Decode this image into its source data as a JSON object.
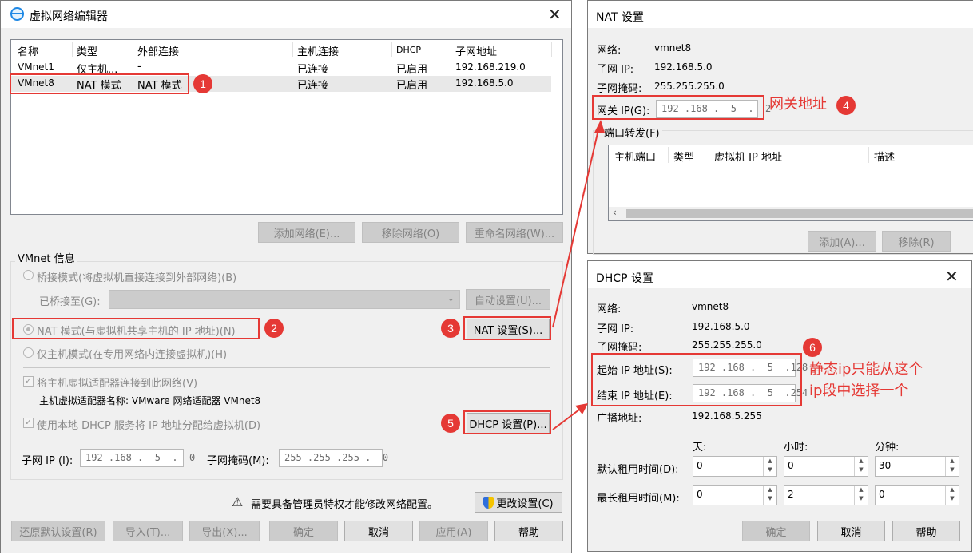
{
  "colors": {
    "accent": "#e53935",
    "dialog_bg": "#f0f0f0"
  },
  "main": {
    "title": "虚拟网络编辑器",
    "table": {
      "headers": [
        "名称",
        "类型",
        "外部连接",
        "主机连接",
        "DHCP",
        "子网地址"
      ],
      "rows": [
        [
          "VMnet1",
          "仅主机...",
          "-",
          "已连接",
          "已启用",
          "192.168.219.0"
        ],
        [
          "VMnet8",
          "NAT 模式",
          "NAT 模式",
          "已连接",
          "已启用",
          "192.168.5.0"
        ]
      ]
    },
    "add_network": "添加网络(E)...",
    "remove_network": "移除网络(O)",
    "rename_network": "重命名网络(W)...",
    "vmnet_info": "VMnet 信息",
    "bridge_mode": "桥接模式(将虚拟机直接连接到外部网络)(B)",
    "bridged_to": "已桥接至(G):",
    "auto_settings": "自动设置(U)...",
    "nat_mode": "NAT 模式(与虚拟机共享主机的 IP 地址)(N)",
    "nat_settings": "NAT 设置(S)...",
    "host_only_mode": "仅主机模式(在专用网络内连接虚拟机)(H)",
    "connect_adapter": "将主机虚拟适配器连接到此网络(V)",
    "adapter_name": "主机虚拟适配器名称: VMware 网络适配器 VMnet8",
    "use_dhcp": "使用本地 DHCP 服务将 IP 地址分配给虚拟机(D)",
    "dhcp_settings": "DHCP 设置(P)...",
    "subnet_ip_label": "子网 IP (I):",
    "subnet_ip": "192 .168 .  5  .  0",
    "subnet_mask_label": "子网掩码(M):",
    "subnet_mask": "255 .255 .255 .  0",
    "admin_warning": "需要具备管理员特权才能修改网络配置。",
    "change_settings": "更改设置(C)",
    "restore_defaults": "还原默认设置(R)",
    "import": "导入(T)...",
    "export": "导出(X)...",
    "ok": "确定",
    "cancel": "取消",
    "apply": "应用(A)",
    "help": "帮助"
  },
  "nat": {
    "title": "NAT 设置",
    "network_label": "网络:",
    "network": "vmnet8",
    "subnet_ip_label": "子网 IP:",
    "subnet_ip": "192.168.5.0",
    "subnet_mask_label": "子网掩码:",
    "subnet_mask": "255.255.255.0",
    "gateway_label": "网关 IP(G):",
    "gateway": "192 .168 .  5  .  2",
    "port_forwarding": "端口转发(F)",
    "pf_headers": [
      "主机端口",
      "类型",
      "虚拟机 IP 地址",
      "描述"
    ],
    "add": "添加(A)...",
    "remove": "移除(R)"
  },
  "dhcp": {
    "title": "DHCP 设置",
    "network_label": "网络:",
    "network": "vmnet8",
    "subnet_ip_label": "子网 IP:",
    "subnet_ip": "192.168.5.0",
    "subnet_mask_label": "子网掩码:",
    "subnet_mask": "255.255.255.0",
    "start_label": "起始 IP 地址(S):",
    "start_ip": "192 .168 .  5  .128",
    "end_label": "结束 IP 地址(E):",
    "end_ip": "192 .168 .  5  .254",
    "broadcast_label": "广播地址:",
    "broadcast": "192.168.5.255",
    "days": "天:",
    "hours": "小时:",
    "minutes": "分钟:",
    "default_lease": "默认租用时间(D):",
    "max_lease": "最长租用时间(M):",
    "default_values": [
      "0",
      "0",
      "30"
    ],
    "max_values": [
      "0",
      "2",
      "0"
    ],
    "ok": "确定",
    "cancel": "取消",
    "help": "帮助"
  },
  "annotations": {
    "badges": [
      "1",
      "2",
      "3",
      "4",
      "5",
      "6"
    ],
    "gateway_note": "网关地址",
    "range_note_1": "静态ip只能从这个",
    "range_note_2": "ip段中选择一个"
  }
}
